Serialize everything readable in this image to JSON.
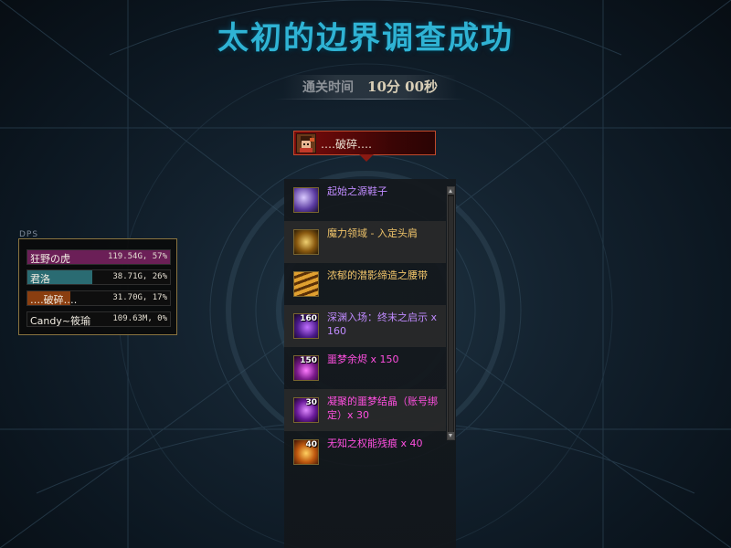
{
  "title": "太初的边界调查成功",
  "clear_time": {
    "label": "通关时间",
    "value": "10分 00秒"
  },
  "player": {
    "name": "‥‥破碎‥‥",
    "avatar_icon": "character-portrait-icon"
  },
  "rewards": [
    {
      "name": "起始之源鞋子",
      "color": "#c08bff",
      "icon": "boots-icon",
      "count": ""
    },
    {
      "name": "魔力领域 - 入定头肩",
      "color": "#f0c46a",
      "icon": "shoulder-armor-icon",
      "count": ""
    },
    {
      "name": "浓郁的潜影缔造之腰带",
      "color": "#f0c46a",
      "icon": "belt-icon",
      "count": ""
    },
    {
      "name": "深渊入场：终末之启示 x 160",
      "color": "#c08bff",
      "icon": "abyss-ticket-icon",
      "count": "160"
    },
    {
      "name": "噩梦余烬 x 150",
      "color": "#ff4fe0",
      "icon": "nightmare-ember-icon",
      "count": "150"
    },
    {
      "name": "凝聚的噩梦结晶（账号绑定）x 30",
      "color": "#ff4fe0",
      "icon": "nightmare-crystal-icon",
      "count": "30"
    },
    {
      "name": "无知之权能残痕 x 40",
      "color": "#ff4fe0",
      "icon": "power-remnant-icon",
      "count": "40"
    }
  ],
  "dps": {
    "title": "DPS",
    "rows": [
      {
        "name": "狂野の虎",
        "value": "119.54G, 57%",
        "share": 0.57,
        "color": "#6b1f57"
      },
      {
        "name": "君洛",
        "value": "38.71G, 26%",
        "share": 0.26,
        "color": "#2a6b72"
      },
      {
        "name": "‥‥破碎‥‥",
        "value": "31.70G, 17%",
        "share": 0.17,
        "color": "#8a3e10"
      },
      {
        "name": "Candy~筱瑜",
        "value": "109.63M, 0%",
        "share": 0.0,
        "color": "#444444"
      }
    ]
  }
}
